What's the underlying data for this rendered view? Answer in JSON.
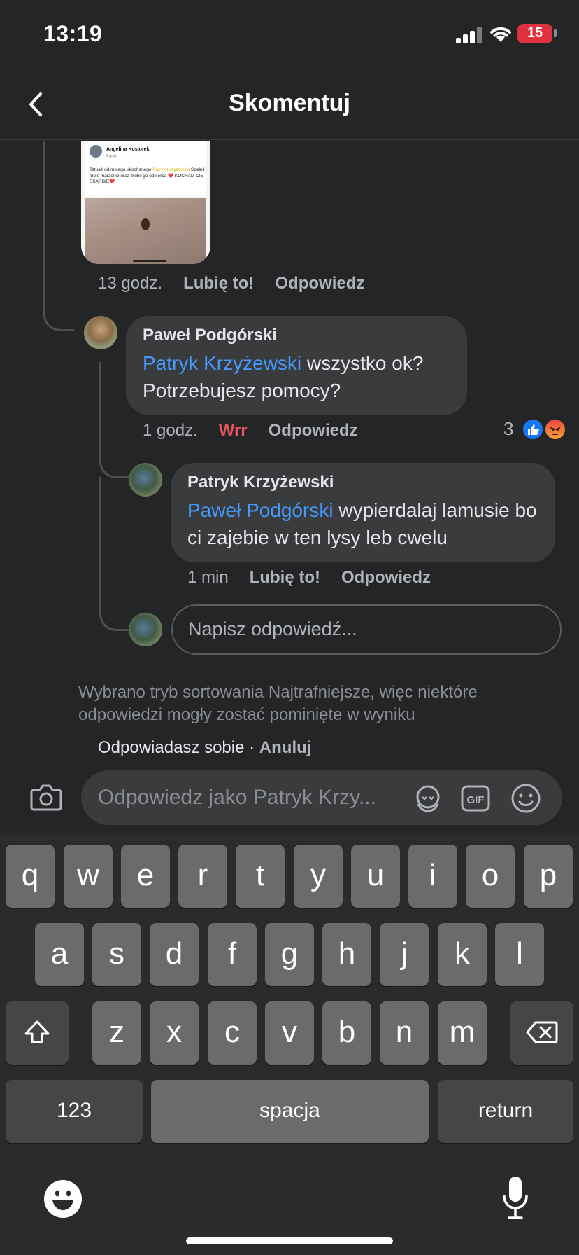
{
  "status": {
    "time": "13:19",
    "battery": "15"
  },
  "header": {
    "title": "Skomentuj"
  },
  "post_preview": {
    "author": "Angelina Kosiorek",
    "time": "2 godz.",
    "text_before": "Tatuaż od mojego ukochanego ",
    "mention": "Patryk Krzyżewski",
    "text_after": " Spełnił moje marzenie oraz zrobił go od serca ❤️ KOCHAM CIĘ SKARBIE❤️"
  },
  "post_meta": {
    "time": "13 godz.",
    "like": "Lubię to!",
    "reply": "Odpowiedz"
  },
  "comments": [
    {
      "author": "Paweł Podgórski",
      "mention": "Patryk Krzyżewski",
      "text": " wszystko ok? Potrzebujesz pomocy?",
      "time": "1 godz.",
      "reaction": "Wrr",
      "reply": "Odpowiedz",
      "reaction_count": "3"
    },
    {
      "author": "Patryk Krzyżewski",
      "mention": "Paweł Podgórski",
      "text": " wypierdalaj lamusie bo ci zajebie w ten lysy leb cwelu",
      "time": "1 min",
      "like": "Lubię to!",
      "reply": "Odpowiedz"
    }
  ],
  "reply_box": {
    "placeholder": "Napisz odpowiedź..."
  },
  "sort_note": "Wybrano tryb sortowania Najtrafniejsze, więc niektóre odpowiedzi mogły zostać pominięte w wyniku",
  "composer": {
    "replying_to": "Odpowiadasz sobie",
    "separator": " · ",
    "cancel": "Anuluj",
    "placeholder": "Odpowiedz jako Patryk Krzy..."
  },
  "keyboard": {
    "row1": [
      "q",
      "w",
      "e",
      "r",
      "t",
      "y",
      "u",
      "i",
      "o",
      "p"
    ],
    "row2": [
      "a",
      "s",
      "d",
      "f",
      "g",
      "h",
      "j",
      "k",
      "l"
    ],
    "row3": [
      "z",
      "x",
      "c",
      "v",
      "b",
      "n",
      "m"
    ],
    "numbers": "123",
    "space": "spacja",
    "return": "return"
  },
  "colors": {
    "mention": "#4599ff",
    "angry": "#e4565f",
    "background": "#242526",
    "bubble": "#3a3b3c"
  }
}
